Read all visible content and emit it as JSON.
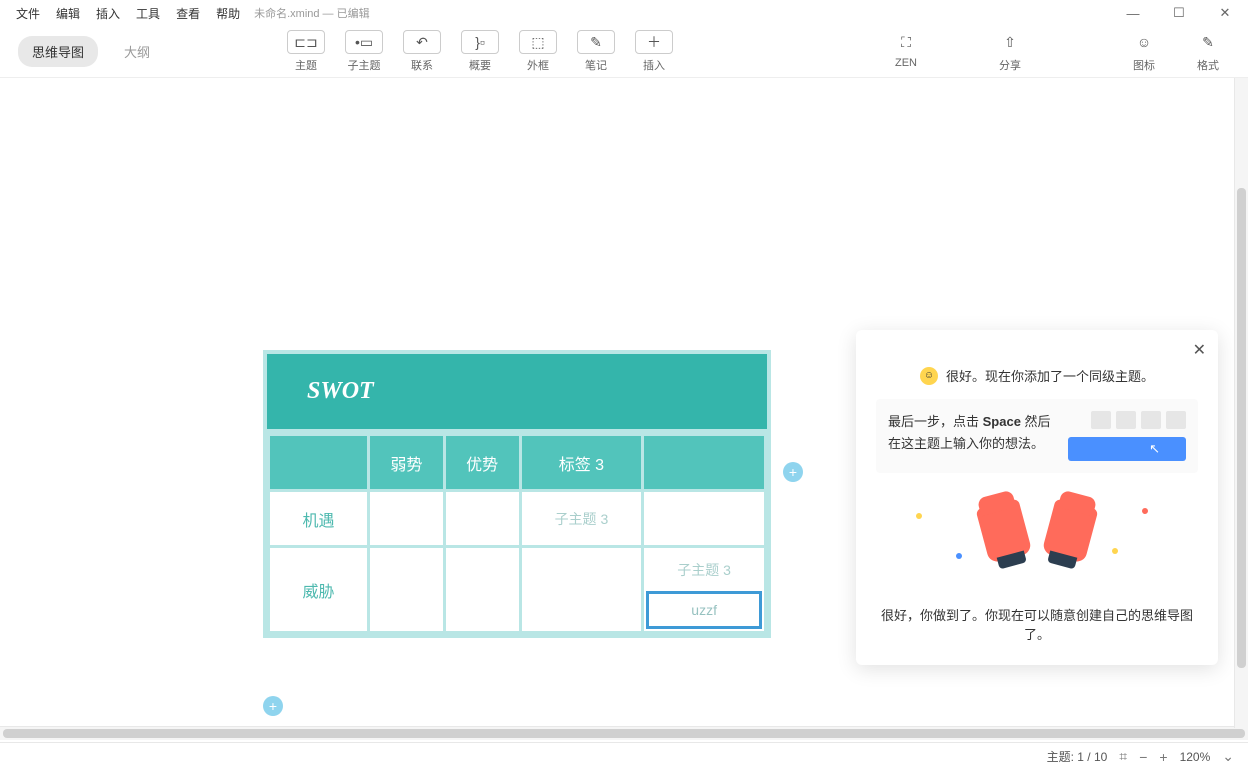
{
  "menu": [
    "文件",
    "编辑",
    "插入",
    "工具",
    "查看",
    "帮助"
  ],
  "docTitle": "未命名.xmind  — 已编辑",
  "viewTabs": {
    "mindmap": "思维导图",
    "outline": "大纲"
  },
  "tools": {
    "topic": "主题",
    "subtopic": "子主题",
    "relation": "联系",
    "summary": "概要",
    "boundary": "外框",
    "notes": "笔记",
    "insert": "插入",
    "zen": "ZEN",
    "share": "分享",
    "iconlib": "图标",
    "format": "格式"
  },
  "swot": {
    "title": "SWOT",
    "cols": [
      "",
      "弱势",
      "优势",
      "标签 3",
      ""
    ],
    "row1_label": "机遇",
    "row1_sub": "子主题 3",
    "row2_label": "威胁",
    "row2_sub": "子主题 3",
    "row2_edit": "uzzf"
  },
  "tutorial": {
    "line1": "很好。现在你添加了一个同级主题。",
    "step_prefix": "最后一步，点击 ",
    "step_key": "Space",
    "step_suffix": " 然后在这主题上输入你的想法。",
    "line2": "很好，你做到了。你现在可以随意创建自己的思维导图了。"
  },
  "status": {
    "topics": "主题: 1 / 10",
    "zoom": "120%"
  }
}
